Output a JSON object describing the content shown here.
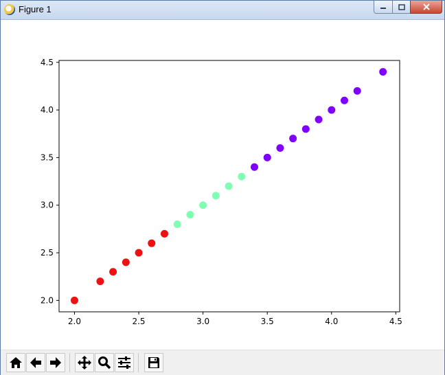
{
  "window": {
    "title": "Figure 1",
    "title_icon": "matplotlib-icon"
  },
  "window_controls": {
    "minimize": "minimize-icon",
    "maximize": "maximize-icon",
    "close": "close-icon"
  },
  "toolbar": {
    "buttons": [
      {
        "name": "home-button",
        "icon": "home-icon"
      },
      {
        "name": "back-button",
        "icon": "arrow-left-icon"
      },
      {
        "name": "forward-button",
        "icon": "arrow-right-icon"
      },
      {
        "name": "pan-button",
        "icon": "move-icon"
      },
      {
        "name": "zoom-button",
        "icon": "magnifier-icon"
      },
      {
        "name": "configure-subplots-button",
        "icon": "sliders-icon"
      },
      {
        "name": "save-button",
        "icon": "floppy-disk-icon"
      }
    ]
  },
  "chart_data": {
    "type": "scatter",
    "x": [
      2.0,
      2.2,
      2.3,
      2.4,
      2.5,
      2.6,
      2.7,
      2.8,
      2.9,
      3.0,
      3.1,
      3.2,
      3.3,
      3.4,
      3.5,
      3.6,
      3.7,
      3.8,
      3.9,
      4.0,
      4.1,
      4.2,
      4.4
    ],
    "y": [
      2.0,
      2.2,
      2.3,
      2.4,
      2.5,
      2.6,
      2.7,
      2.8,
      2.9,
      3.0,
      3.1,
      3.2,
      3.3,
      3.4,
      3.5,
      3.6,
      3.7,
      3.8,
      3.9,
      4.0,
      4.1,
      4.2,
      4.4
    ],
    "colors": [
      "#ee1111",
      "#ee1111",
      "#ee1111",
      "#ee1111",
      "#ee1111",
      "#ee1111",
      "#ee1111",
      "#80ffb4",
      "#80ffb4",
      "#80ffb4",
      "#80ffb4",
      "#80ffb4",
      "#80ffb4",
      "#8000ff",
      "#8000ff",
      "#8000ff",
      "#8000ff",
      "#8000ff",
      "#8000ff",
      "#8000ff",
      "#8000ff",
      "#8000ff",
      "#8000ff"
    ],
    "xlim": [
      1.88,
      4.53
    ],
    "ylim": [
      1.88,
      4.52
    ],
    "xticks": [
      2.0,
      2.5,
      3.0,
      3.5,
      4.0,
      4.5
    ],
    "yticks": [
      2.0,
      2.5,
      3.0,
      3.5,
      4.0,
      4.5
    ],
    "xtick_labels": [
      "2.0",
      "2.5",
      "3.0",
      "3.5",
      "4.0",
      "4.5"
    ],
    "ytick_labels": [
      "2.0",
      "2.5",
      "3.0",
      "3.5",
      "4.0",
      "4.5"
    ],
    "title": "",
    "xlabel": "",
    "ylabel": "",
    "grid": false
  }
}
